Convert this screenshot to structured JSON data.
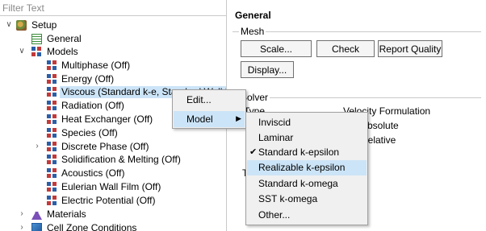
{
  "filter": {
    "placeholder": "Filter Text"
  },
  "tree": {
    "setup": "Setup",
    "general": "General",
    "models": "Models",
    "model_items": [
      "Multiphase (Off)",
      "Energy (Off)",
      "Viscous (Standard k-e, Standard Wall Fn)",
      "Radiation (Off)",
      "Heat Exchanger (Off)",
      "Species (Off)",
      "Discrete Phase (Off)",
      "Solidification & Melting (Off)",
      "Acoustics (Off)",
      "Eulerian Wall Film (Off)",
      "Electric Potential (Off)"
    ],
    "materials": "Materials",
    "cell_zone": "Cell Zone Conditions"
  },
  "general": {
    "title": "General",
    "mesh_group": "Mesh",
    "buttons": {
      "scale": "Scale...",
      "check": "Check",
      "report_quality": "Report Quality",
      "display": "Display..."
    },
    "solver_group": "Solver",
    "type_label": "Type",
    "velocity_formulation": "Velocity Formulation",
    "absolute": "Absolute",
    "relative": "Relative",
    "time_label": "Ti"
  },
  "context_menu": {
    "edit": "Edit...",
    "model": "Model"
  },
  "submenu": {
    "items": [
      "Inviscid",
      "Laminar",
      "Standard k-epsilon",
      "Realizable k-epsilon",
      "Standard k-omega",
      "SST k-omega",
      "Other..."
    ],
    "checked_index": 2,
    "hover_index": 3
  },
  "colors": {
    "selection": "#cce4f7",
    "menu_bg": "#f0f0f0"
  }
}
